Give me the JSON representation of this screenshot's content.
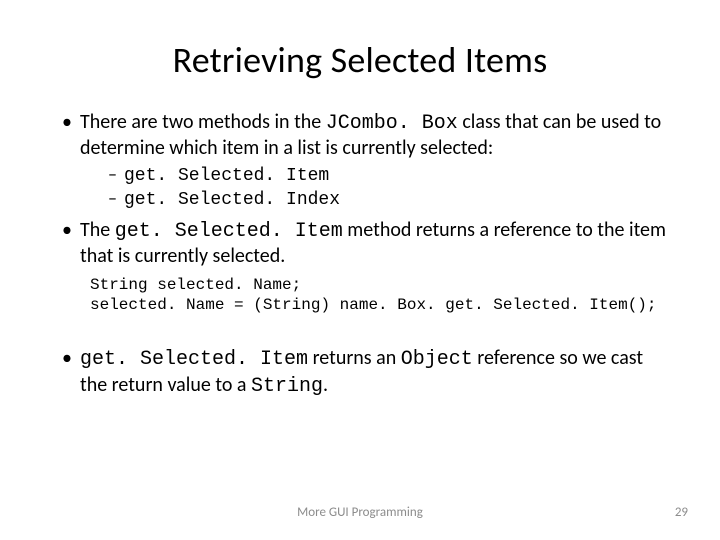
{
  "title": "Retrieving Selected Items",
  "bullets": {
    "b1_pre": "There are two methods in the ",
    "b1_code": "JCombo. Box",
    "b1_post": " class that can be used to determine which item in a list is currently selected:",
    "b1_sub1": "get. Selected. Item",
    "b1_sub2": "get. Selected. Index",
    "b2_pre": "The ",
    "b2_code": "get. Selected. Item",
    "b2_post": " method returns a reference to the item that is currently selected.",
    "code_line1": "String selected. Name;",
    "code_line2": "selected. Name = (String) name. Box. get. Selected. Item();",
    "b3_code1": "get. Selected. Item",
    "b3_mid1": " returns an ",
    "b3_code2": "Object",
    "b3_mid2": " reference so we cast the return value to a ",
    "b3_code3": "String",
    "b3_end": "."
  },
  "footer": {
    "center": "More GUI Programming",
    "page": "29"
  }
}
